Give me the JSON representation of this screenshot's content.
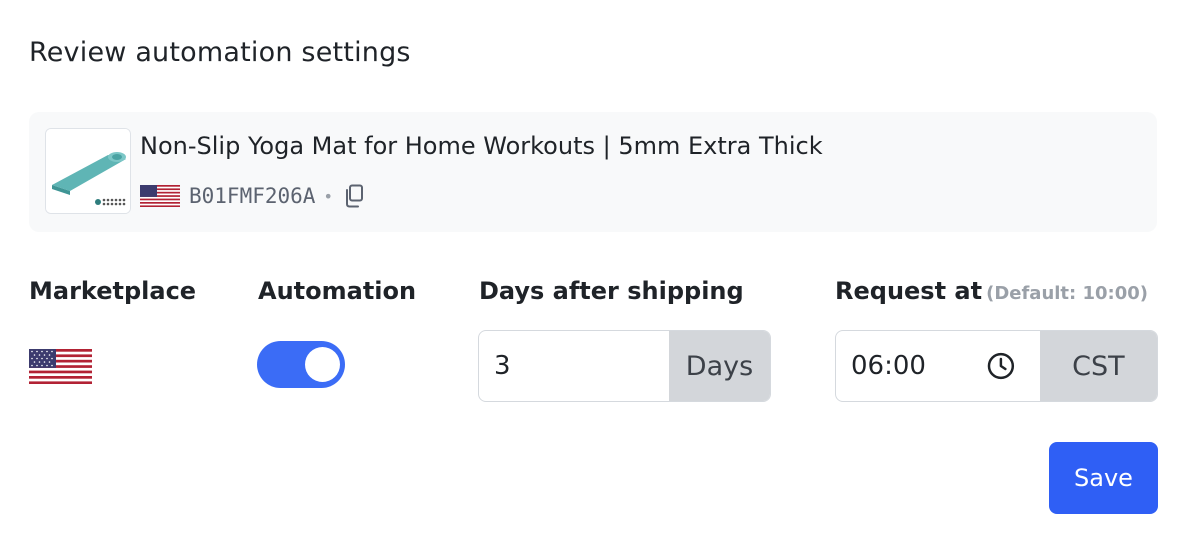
{
  "page": {
    "title": "Review automation settings"
  },
  "product": {
    "name": "Non-Slip Yoga Mat for Home Workouts | 5mm Extra Thick",
    "asin": "B01FMF206A",
    "separator": "•",
    "flag_icon": "us-flag-icon",
    "copy_icon": "copy-icon",
    "thumbnail_color": "#5fb5b5"
  },
  "labels": {
    "marketplace": "Marketplace",
    "automation": "Automation",
    "days_after_shipping": "Days after shipping",
    "request_at": "Request at",
    "request_at_hint": "(Default: 10:00)"
  },
  "fields": {
    "marketplace_flag": "us-flag-icon",
    "automation_enabled": true,
    "days_value": "3",
    "days_unit": "Days",
    "time_value": "06:00",
    "timezone": "CST",
    "clock_icon": "clock-icon"
  },
  "actions": {
    "save_label": "Save"
  },
  "colors": {
    "accent": "#2f5ff5",
    "toggle_on": "#3b6cf6",
    "card_bg": "#f8f9fa",
    "addon_bg": "#d3d6da"
  }
}
